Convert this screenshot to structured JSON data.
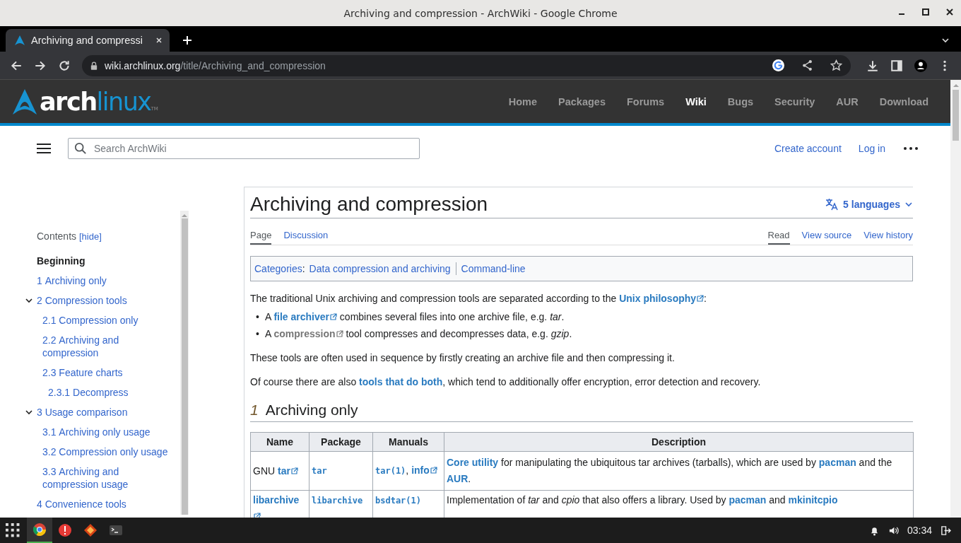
{
  "window": {
    "title": "Archiving and compression - ArchWiki - Google Chrome"
  },
  "browser": {
    "tabs": [
      {
        "title": "Archiving and compressi",
        "selected": true
      }
    ],
    "url": {
      "host": "wiki.archlinux.org",
      "path": "/title/Archiving_and_compression"
    }
  },
  "site": {
    "logo": {
      "first": "arch",
      "second": "linux",
      "mark": "TM"
    },
    "nav": [
      {
        "label": "Home",
        "selected": false
      },
      {
        "label": "Packages",
        "selected": false
      },
      {
        "label": "Forums",
        "selected": false
      },
      {
        "label": "Wiki",
        "selected": true
      },
      {
        "label": "Bugs",
        "selected": false
      },
      {
        "label": "Security",
        "selected": false
      },
      {
        "label": "AUR",
        "selected": false
      },
      {
        "label": "Download",
        "selected": false
      }
    ]
  },
  "wiki_header": {
    "search": {
      "placeholder": "Search ArchWiki"
    },
    "links": [
      "Create account",
      "Log in"
    ]
  },
  "toc": {
    "title": "Contents",
    "toggle": "[hide]",
    "items": [
      {
        "text": "Beginning",
        "selected": true
      },
      {
        "number": "1",
        "text": "Archiving only",
        "selected": false
      },
      {
        "number": "2",
        "text": "Compression tools",
        "selected": false,
        "expanded": true,
        "children": [
          {
            "number": "2.1",
            "text": "Compression only",
            "selected": false
          },
          {
            "number": "2.2",
            "text": "Archiving and compression",
            "selected": false
          },
          {
            "number": "2.3",
            "text": "Feature charts",
            "selected": false,
            "children": [
              {
                "number": "2.3.1",
                "text": "Decompress",
                "selected": false
              }
            ]
          }
        ]
      },
      {
        "number": "3",
        "text": "Usage comparison",
        "selected": false,
        "expanded": true,
        "children": [
          {
            "number": "3.1",
            "text": "Archiving only usage",
            "selected": false
          },
          {
            "number": "3.2",
            "text": "Compression only usage",
            "selected": false
          },
          {
            "number": "3.3",
            "text": "Archiving and compression usage",
            "selected": false
          }
        ]
      },
      {
        "number": "4",
        "text": "Convenience tools",
        "selected": false
      }
    ]
  },
  "article": {
    "title": "Archiving and compression",
    "languages": "5 languages",
    "page_tabs": [
      {
        "label": "Page",
        "selected": true
      },
      {
        "label": "Discussion",
        "selected": false
      }
    ],
    "view_tabs": [
      {
        "label": "Read",
        "selected": true
      },
      {
        "label": "View source",
        "selected": false
      },
      {
        "label": "View history",
        "selected": false
      }
    ],
    "categories": {
      "label": "Categories",
      "colon": ":",
      "items": [
        "Data compression and archiving",
        "Command-line"
      ]
    },
    "blocks": [
      {
        "kind": "p",
        "segments": [
          {
            "t": "The traditional Unix archiving and compression tools are separated according to the "
          },
          {
            "t": "Unix philosophy",
            "kind": "ext"
          },
          {
            "t": ":"
          }
        ]
      },
      {
        "kind": "ul",
        "items": [
          {
            "marker": "•",
            "segments": [
              {
                "t": "A "
              },
              {
                "t": "file archiver",
                "kind": "ext"
              },
              {
                "t": " combines several files into one archive file, e.g. "
              },
              {
                "t": "tar",
                "kind": "em"
              },
              {
                "t": "."
              }
            ]
          },
          {
            "marker": "•",
            "segments": [
              {
                "t": "A "
              },
              {
                "t": "compression",
                "kind": "ext-muted"
              },
              {
                "t": " tool compresses and decompresses data, e.g. "
              },
              {
                "t": "gzip",
                "kind": "em"
              },
              {
                "t": "."
              }
            ]
          }
        ]
      },
      {
        "kind": "p",
        "segments": [
          {
            "t": "These tools are often used in sequence by firstly creating an archive file and then compressing it."
          }
        ]
      },
      {
        "kind": "p",
        "segments": [
          {
            "t": "Of course there are also "
          },
          {
            "t": "tools that do both",
            "kind": "link"
          },
          {
            "t": ", which tend to additionally offer encryption, error detection and recovery."
          }
        ]
      },
      {
        "kind": "h2",
        "number": "1",
        "text": "Archiving only"
      },
      {
        "kind": "table",
        "columns": [
          "Name",
          "Package",
          "Manuals",
          "Description"
        ],
        "rows": [
          [
            [
              {
                "t": "GNU "
              },
              {
                "t": "tar",
                "kind": "ext"
              }
            ],
            [
              {
                "t": "tar",
                "kind": "code"
              }
            ],
            [
              {
                "t": "tar(1)",
                "kind": "code"
              },
              {
                "t": ", "
              },
              {
                "t": "info",
                "kind": "ext"
              }
            ],
            [
              {
                "t": "Core utility",
                "kind": "link"
              },
              {
                "t": " for manipulating the ubiquitous tar archives (tarballs), which are used by "
              },
              {
                "t": "pacman",
                "kind": "link"
              },
              {
                "t": " and the "
              },
              {
                "t": "AUR",
                "kind": "link"
              },
              {
                "t": "."
              }
            ]
          ],
          [
            [
              {
                "t": "libarchive",
                "kind": "ext"
              }
            ],
            [
              {
                "t": "libarchive",
                "kind": "code"
              }
            ],
            [
              {
                "t": "bsdtar(1)",
                "kind": "code"
              }
            ],
            [
              {
                "t": "Implementation of "
              },
              {
                "t": "tar",
                "kind": "em"
              },
              {
                "t": " and "
              },
              {
                "t": "cpio",
                "kind": "em"
              },
              {
                "t": " that also offers a library. Used by "
              },
              {
                "t": "pacman",
                "kind": "link"
              },
              {
                "t": " and "
              },
              {
                "t": "mkinitcpio",
                "kind": "link"
              }
            ]
          ]
        ]
      }
    ]
  },
  "taskbar": {
    "apps": [
      {
        "kind": "browser",
        "selected": true
      },
      {
        "kind": "alert",
        "selected": false
      },
      {
        "kind": "diamond",
        "selected": false
      },
      {
        "kind": "terminal",
        "selected": false
      }
    ],
    "clock": "03:34"
  }
}
